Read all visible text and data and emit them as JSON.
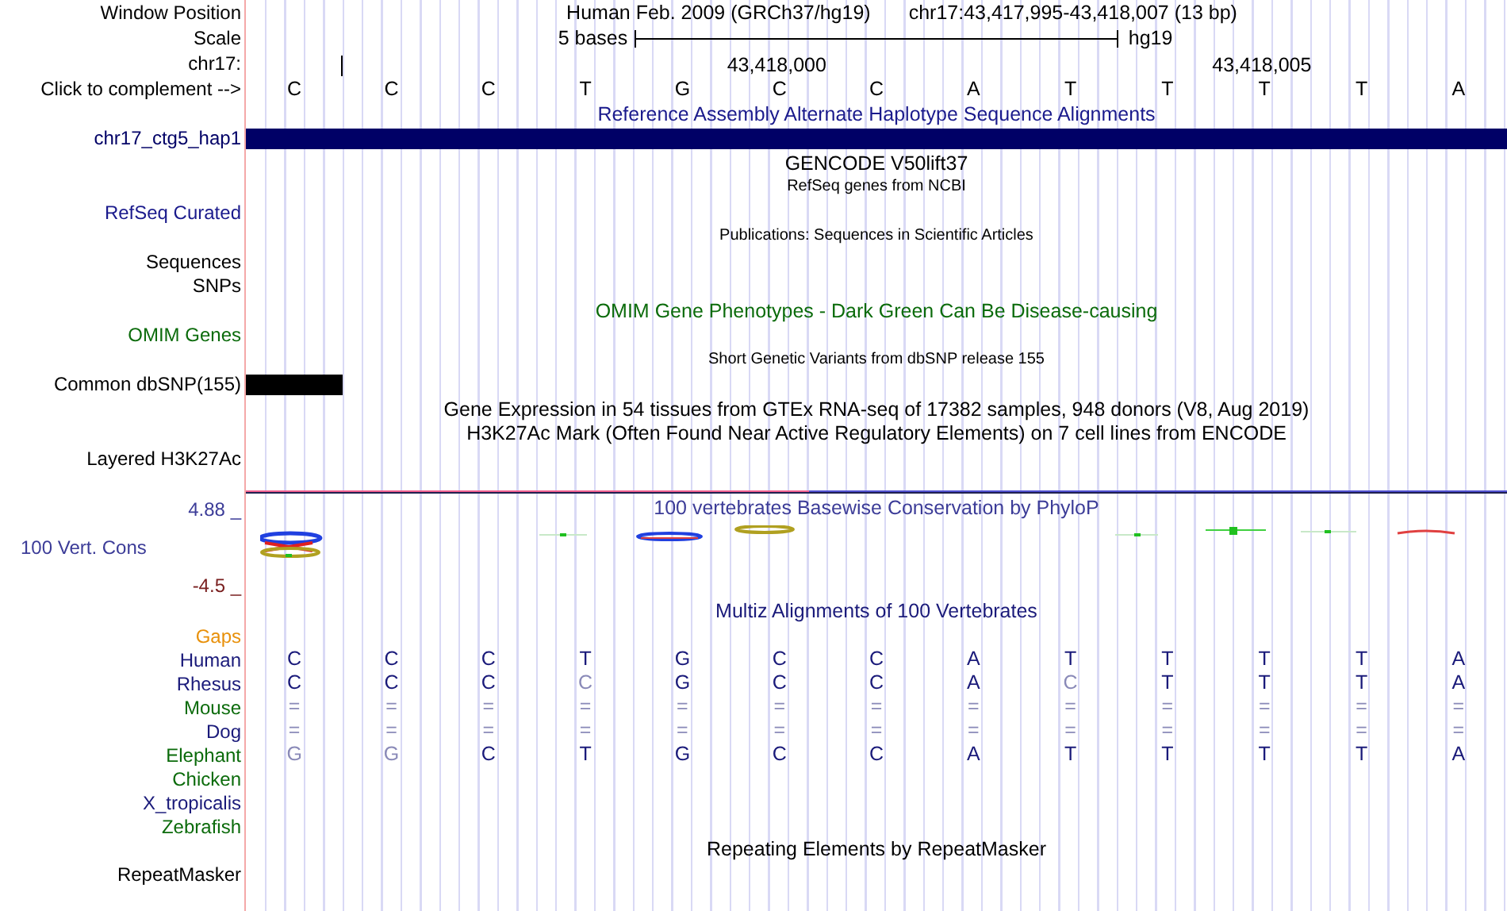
{
  "header": {
    "window_position_label": "Window Position",
    "assembly": "Human Feb. 2009 (GRCh37/hg19)",
    "position": "chr17:43,417,995-43,418,007 (13 bp)",
    "scale_label": "Scale",
    "scale_text": "5 bases",
    "scale_db": "hg19",
    "chrom_label": "chr17:",
    "complement_label": "Click to complement -->",
    "bases": [
      {
        "base": "C"
      },
      {
        "base": "C"
      },
      {
        "base": "C"
      },
      {
        "base": "T"
      },
      {
        "base": "G"
      },
      {
        "base": "C",
        "tick_label": "43,418,000"
      },
      {
        "base": "C"
      },
      {
        "base": "A"
      },
      {
        "base": "T"
      },
      {
        "base": "T"
      },
      {
        "base": "T",
        "tick_label": "43,418,005"
      },
      {
        "base": "T"
      },
      {
        "base": "A"
      }
    ]
  },
  "tracks": [
    {
      "kind": "title",
      "text": "Reference Assembly Alternate Haplotype Sequence Alignments",
      "color": "#1a1a8c"
    },
    {
      "kind": "full_bar",
      "label": "chr17_ctg5_hap1",
      "color": "#000066"
    },
    {
      "kind": "title",
      "text": "GENCODE V50lift37",
      "color": "#000000"
    },
    {
      "kind": "note",
      "text": "RefSeq genes from NCBI",
      "color": "#000000"
    },
    {
      "kind": "label",
      "label": "RefSeq Curated",
      "color": "#1a1a8c"
    },
    {
      "kind": "note",
      "text": "Publications: Sequences in Scientific Articles",
      "color": "#000000"
    },
    {
      "kind": "label",
      "label": "Sequences",
      "color": "#000000"
    },
    {
      "kind": "label",
      "label": "SNPs",
      "color": "#000000"
    },
    {
      "kind": "title",
      "text": "OMIM Gene Phenotypes - Dark Green Can Be Disease-causing",
      "color": "#0b6b0b"
    },
    {
      "kind": "label",
      "label": "OMIM Genes",
      "color": "#0b6b0b"
    },
    {
      "kind": "note",
      "text": "Short Genetic Variants from dbSNP release 155",
      "color": "#000000"
    },
    {
      "kind": "base_bar",
      "label": "Common dbSNP(155)",
      "color": "#000000"
    },
    {
      "kind": "title",
      "text": "Gene Expression in 54 tissues from GTEx RNA-seq of 17382 samples, 948 donors (V8, Aug 2019)",
      "color": "#000000"
    },
    {
      "kind": "title",
      "text": "H3K27Ac Mark (Often Found Near Active Regulatory Elements) on 7 cell lines from ENCODE",
      "color": "#000000"
    },
    {
      "kind": "label",
      "label": "Layered H3K27Ac",
      "color": "#000000"
    }
  ],
  "conservation": {
    "title": "100 vertebrates Basewise Conservation by PhyloP",
    "max_label": "4.88 _",
    "label": "100 Vert. Cons",
    "min_label": "-4.5 _"
  },
  "multiz": {
    "title": "Multiz Alignments of 100 Vertebrates",
    "species": [
      {
        "name": "Gaps",
        "color": "#e8900a"
      },
      {
        "name": "Human",
        "color": "#1a1a7a",
        "bases": [
          {
            "b": "C",
            "faded": false
          },
          {
            "b": "C",
            "faded": false
          },
          {
            "b": "C",
            "faded": false
          },
          {
            "b": "T",
            "faded": false
          },
          {
            "b": "G",
            "faded": false
          },
          {
            "b": "C",
            "faded": false
          },
          {
            "b": "C",
            "faded": false
          },
          {
            "b": "A",
            "faded": false
          },
          {
            "b": "T",
            "faded": false
          },
          {
            "b": "T",
            "faded": false
          },
          {
            "b": "T",
            "faded": false
          },
          {
            "b": "T",
            "faded": false
          },
          {
            "b": "A",
            "faded": false
          }
        ]
      },
      {
        "name": "Rhesus",
        "color": "#1a1a7a",
        "bases": [
          {
            "b": "C",
            "faded": false
          },
          {
            "b": "C",
            "faded": false
          },
          {
            "b": "C",
            "faded": false
          },
          {
            "b": "C",
            "faded": true
          },
          {
            "b": "G",
            "faded": false
          },
          {
            "b": "C",
            "faded": false
          },
          {
            "b": "C",
            "faded": false
          },
          {
            "b": "A",
            "faded": false
          },
          {
            "b": "C",
            "faded": true
          },
          {
            "b": "T",
            "faded": false
          },
          {
            "b": "T",
            "faded": false
          },
          {
            "b": "T",
            "faded": false
          },
          {
            "b": "A",
            "faded": false
          }
        ]
      },
      {
        "name": "Mouse",
        "color": "#0b6b0b",
        "bases": [
          {
            "b": "=",
            "faded": true
          },
          {
            "b": "=",
            "faded": true
          },
          {
            "b": "=",
            "faded": true
          },
          {
            "b": "=",
            "faded": true
          },
          {
            "b": "=",
            "faded": true
          },
          {
            "b": "=",
            "faded": true
          },
          {
            "b": "=",
            "faded": true
          },
          {
            "b": "=",
            "faded": true
          },
          {
            "b": "=",
            "faded": true
          },
          {
            "b": "=",
            "faded": true
          },
          {
            "b": "=",
            "faded": true
          },
          {
            "b": "=",
            "faded": true
          },
          {
            "b": "=",
            "faded": true
          }
        ]
      },
      {
        "name": "Dog",
        "color": "#1a1a7a",
        "bases": [
          {
            "b": "=",
            "faded": true
          },
          {
            "b": "=",
            "faded": true
          },
          {
            "b": "=",
            "faded": true
          },
          {
            "b": "=",
            "faded": true
          },
          {
            "b": "=",
            "faded": true
          },
          {
            "b": "=",
            "faded": true
          },
          {
            "b": "=",
            "faded": true
          },
          {
            "b": "=",
            "faded": true
          },
          {
            "b": "=",
            "faded": true
          },
          {
            "b": "=",
            "faded": true
          },
          {
            "b": "=",
            "faded": true
          },
          {
            "b": "=",
            "faded": true
          },
          {
            "b": "=",
            "faded": true
          }
        ]
      },
      {
        "name": "Elephant",
        "color": "#0b6b0b",
        "bases": [
          {
            "b": "G",
            "faded": true
          },
          {
            "b": "G",
            "faded": true
          },
          {
            "b": "C",
            "faded": false
          },
          {
            "b": "T",
            "faded": false
          },
          {
            "b": "G",
            "faded": false
          },
          {
            "b": "C",
            "faded": false
          },
          {
            "b": "C",
            "faded": false
          },
          {
            "b": "A",
            "faded": false
          },
          {
            "b": "T",
            "faded": false
          },
          {
            "b": "T",
            "faded": false
          },
          {
            "b": "T",
            "faded": false
          },
          {
            "b": "T",
            "faded": false
          },
          {
            "b": "A",
            "faded": false
          }
        ]
      },
      {
        "name": "Chicken",
        "color": "#0b6b0b"
      },
      {
        "name": "X_tropicalis",
        "color": "#1a1a7a"
      },
      {
        "name": "Zebrafish",
        "color": "#0b6b0b"
      }
    ]
  },
  "repeats": {
    "title": "Repeating Elements by RepeatMasker",
    "label": "RepeatMasker"
  }
}
